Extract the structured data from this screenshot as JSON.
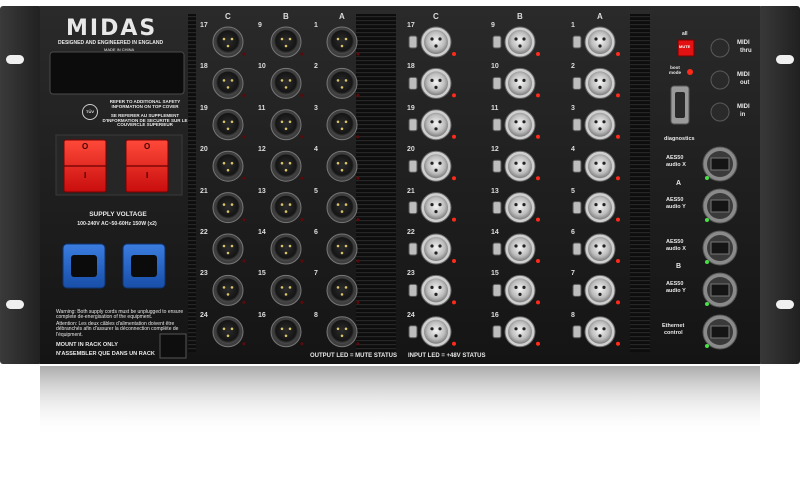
{
  "brand": {
    "logo": "MIDAS",
    "tagline": "DESIGNED AND ENGINEERED IN ENGLAND",
    "origin": "MADE IN CHINA"
  },
  "safety": {
    "en": "REFER TO ADDITIONAL SAFETY INFORMATION ON TOP COVER",
    "fr": "SE REFERER AU SUPPLEMENT D'INFORMATION DE SECURITE SUR LE COUVERCLE SUPERIEUR",
    "badge": "TÜV"
  },
  "power": {
    "title": "SUPPLY VOLTAGE",
    "spec": "100-240V  AC~50-60Hz 150W (x2)",
    "switch_on": "O",
    "switch_off": "I",
    "warning_en": "Warning: Both supply cords must be unplugged to ensure complete de-energisation of the equipment.",
    "warning_fr": "Attention: Les deux câbles d'alimentation doivent être débranchés afin d'assurer la déconnection complète de l'équipment."
  },
  "rack": {
    "en": "MOUNT IN RACK ONLY",
    "fr": "N'ASSEMBLER QUE DANS UN RACK"
  },
  "outputs": {
    "columns": [
      "C",
      "B",
      "A"
    ],
    "rows": [
      [
        "17",
        "9",
        "1"
      ],
      [
        "18",
        "10",
        "2"
      ],
      [
        "19",
        "11",
        "3"
      ],
      [
        "20",
        "12",
        "4"
      ],
      [
        "21",
        "13",
        "5"
      ],
      [
        "22",
        "14",
        "6"
      ],
      [
        "23",
        "15",
        "7"
      ],
      [
        "24",
        "16",
        "8"
      ]
    ],
    "legend": "OUTPUT LED = MUTE STATUS"
  },
  "inputs": {
    "columns": [
      "C",
      "B",
      "A"
    ],
    "rows": [
      [
        "17",
        "9",
        "1"
      ],
      [
        "18",
        "10",
        "2"
      ],
      [
        "19",
        "11",
        "3"
      ],
      [
        "20",
        "12",
        "4"
      ],
      [
        "21",
        "13",
        "5"
      ],
      [
        "22",
        "14",
        "6"
      ],
      [
        "23",
        "15",
        "7"
      ],
      [
        "24",
        "16",
        "8"
      ]
    ],
    "legend": "INPUT LED = +48V STATUS"
  },
  "control": {
    "mute_top": "all",
    "mute_button": "MUTE",
    "boot": "boot mode",
    "diagnostics": "diagnostics",
    "midi": [
      {
        "label": "MIDI",
        "sub": "thru"
      },
      {
        "label": "MIDI",
        "sub": "out"
      },
      {
        "label": "MIDI",
        "sub": "in"
      }
    ],
    "aes50": [
      {
        "label": "AES50",
        "sub": "audio X"
      },
      {
        "label": "AES50",
        "sub": "audio Y"
      },
      {
        "label": "AES50",
        "sub": "audio X"
      },
      {
        "label": "AES50",
        "sub": "audio Y"
      }
    ],
    "group_a": "A",
    "group_b": "B",
    "ethernet": {
      "label": "Ethernet",
      "sub": "control"
    }
  },
  "colors": {
    "panel": "#1b1b1b",
    "ear": "#2a2a2a",
    "switch": "#e31212",
    "iec": "#1f5fbf",
    "led_red": "#ff2a1a",
    "led_green": "#46e046"
  }
}
